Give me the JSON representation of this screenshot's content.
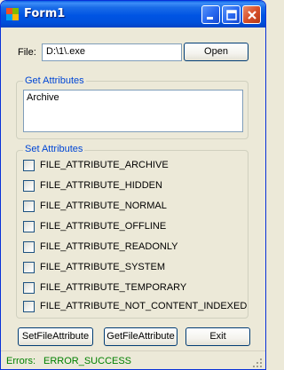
{
  "window": {
    "title": "Form1"
  },
  "file": {
    "label": "File:",
    "value": "D:\\1\\.exe",
    "open_label": "Open"
  },
  "get_attributes": {
    "title": "Get Attributes",
    "value": "Archive"
  },
  "set_attributes": {
    "title": "Set Attributes",
    "items": [
      {
        "label": "FILE_ATTRIBUTE_ARCHIVE",
        "checked": false
      },
      {
        "label": "FILE_ATTRIBUTE_HIDDEN",
        "checked": false
      },
      {
        "label": "FILE_ATTRIBUTE_NORMAL",
        "checked": false
      },
      {
        "label": "FILE_ATTRIBUTE_OFFLINE",
        "checked": false
      },
      {
        "label": "FILE_ATTRIBUTE_READONLY",
        "checked": false
      },
      {
        "label": "FILE_ATTRIBUTE_SYSTEM",
        "checked": false
      },
      {
        "label": "FILE_ATTRIBUTE_TEMPORARY",
        "checked": false
      },
      {
        "label": "FILE_ATTRIBUTE_NOT_CONTENT_INDEXED",
        "checked": false
      }
    ]
  },
  "buttons": {
    "set_label": "SetFileAttribute",
    "get_label": "GetFileAttribute",
    "exit_label": "Exit"
  },
  "status": {
    "label": "Errors:",
    "value": "ERROR_SUCCESS"
  },
  "colors": {
    "title_bar": "#0054e3",
    "group_title": "#0046d5",
    "status_text": "#008000",
    "close_button": "#d8502a"
  },
  "icons": {
    "app": "windows-form-icon",
    "minimize": "minimize-icon",
    "maximize": "maximize-icon",
    "close": "close-icon",
    "grip": "resize-grip-icon"
  }
}
